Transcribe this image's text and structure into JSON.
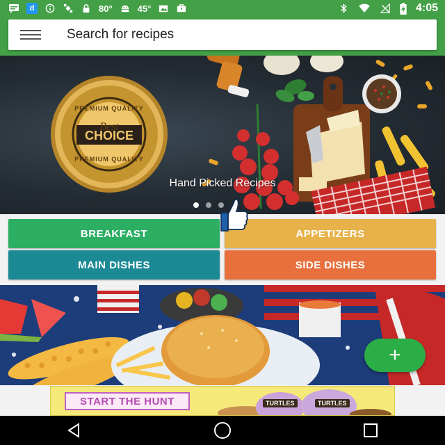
{
  "status_bar": {
    "temp_1": "80°",
    "temp_2": "45°",
    "time": "4:05",
    "left_icons": [
      "message-icon",
      "d-app-icon",
      "info-icon",
      "satellite-icon",
      "lock-icon",
      "android-icon",
      "photo-icon",
      "briefcase-icon"
    ],
    "right_icons": [
      "bluetooth-icon",
      "wifi-icon",
      "no-signal-icon",
      "battery-charging-icon"
    ],
    "d_label": "d"
  },
  "search": {
    "placeholder": "Search for recipes"
  },
  "hero": {
    "caption": "Hand Picked Recipes",
    "badge_top": "PREMIUM QUALITY",
    "badge_line1": "Best",
    "badge_line2": "CHOICE",
    "badge_bottom": "PREMIUM QUALITY",
    "slides": 3,
    "active_slide": 0
  },
  "categories": [
    {
      "label": "BREAKFAST",
      "color": "#2cae63"
    },
    {
      "label": "APPETIZERS",
      "color": "#e7b24a"
    },
    {
      "label": "MAIN DISHES",
      "color": "#1c8a95"
    },
    {
      "label": "SIDE DISHES",
      "color": "#e8703c"
    }
  ],
  "fab": {
    "label": "+"
  },
  "ad": {
    "cta": "START THE HUNT",
    "brand": "TURTLES"
  },
  "navbar": {
    "icons": [
      "back-icon",
      "home-icon",
      "recents-icon"
    ]
  },
  "colors": {
    "app_bar": "#43a047",
    "fab": "#2cae46"
  }
}
